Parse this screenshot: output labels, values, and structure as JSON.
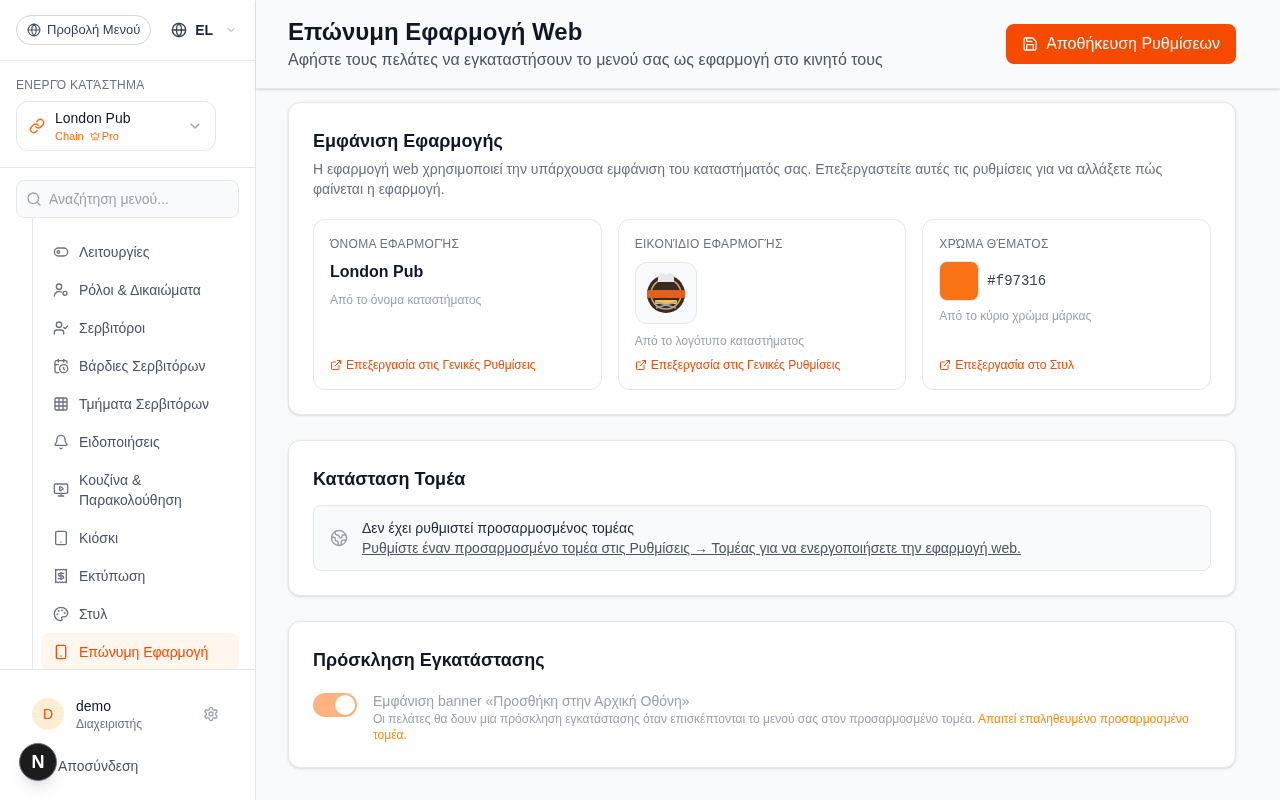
{
  "sidebar": {
    "menu_button": {
      "label": "Προβολή Μενού"
    },
    "language": {
      "label": "EL"
    },
    "store_heading": "ΕΝΕΡΓΌ ΚΑΤΆΣΤΗΜΑ",
    "store": {
      "name": "London Pub",
      "type": "Chain",
      "plan": "Pro"
    },
    "search": {
      "placeholder": "Αναζήτηση μενού..."
    },
    "nav_items": [
      {
        "label": "Λειτουργίες",
        "selected": false
      },
      {
        "label": "Ρόλοι & Δικαιώματα",
        "selected": false
      },
      {
        "label": "Σερβιτόροι",
        "selected": false
      },
      {
        "label": "Βάρδιες Σερβιτόρων",
        "selected": false
      },
      {
        "label": "Τμήματα Σερβιτόρων",
        "selected": false
      },
      {
        "label": "Ειδοποιήσεις",
        "selected": false
      },
      {
        "label": "Κουζίνα & Παρακολούθηση",
        "selected": false
      },
      {
        "label": "Κιόσκι",
        "selected": false
      },
      {
        "label": "Εκτύπωση",
        "selected": false
      },
      {
        "label": "Στυλ",
        "selected": false
      },
      {
        "label": "Επώνυμη Εφαρμογή",
        "selected": true
      }
    ],
    "user": {
      "initial": "D",
      "name": "demo",
      "role": "Διαχειριστής"
    },
    "logout": {
      "label": "Αποσύνδεση"
    }
  },
  "dev_badge": {
    "label": "N"
  },
  "header": {
    "title": "Επώνυμη Εφαρμογή Web",
    "subtitle": "Αφήστε τους πελάτες να εγκαταστήσουν το μενού σας ως εφαρμογή στο κινητό τους",
    "save_button": {
      "label": "Αποθήκευση Ρυθμίσεων"
    }
  },
  "app_appearance": {
    "title": "Εμφάνιση Εφαρμογής",
    "description": "Η εφαρμογή web χρησιμοποιεί την υπάρχουσα εμφάνιση του καταστήματός σας. Επεξεργαστείτε αυτές τις ρυθμίσεις για να αλλάξετε πώς φαίνεται η εφαρμογή.",
    "cards": [
      {
        "kind": "text",
        "label": "ΌΝΟΜΑ ΕΦΑΡΜΟΓΉΣ",
        "value": "London Pub",
        "source": "Από το όνομα καταστήματος",
        "link": "Επεξεργασία στις Γενικές Ρυθμίσεις"
      },
      {
        "kind": "image",
        "label": "ΕΙΚΟΝΊΔΙΟ ΕΦΑΡΜΟΓΉΣ",
        "source": "Από το λογότυπο καταστήματος",
        "link": "Επεξεργασία στις Γενικές Ρυθμίσεις"
      },
      {
        "kind": "color",
        "label": "ΧΡΏΜΑ ΘΈΜΑΤΟΣ",
        "color": "#f97316",
        "value": "#f97316",
        "source": "Από το κύριο χρώμα μάρκας",
        "link": "Επεξεργασία στο Στυλ"
      }
    ]
  },
  "domain_status": {
    "title": "Κατάσταση Τομέα",
    "notice": {
      "title": "Δεν έχει ρυθμιστεί προσαρμοσμένος τομέας",
      "link": "Ρυθμίστε έναν προσαρμοσμένο τομέα στις Ρυθμίσεις → Τομέας για να ενεργοποιήσετε την εφαρμογή web."
    }
  },
  "install_prompt": {
    "title": "Πρόσκληση Εγκατάστασης",
    "toggle": {
      "on": true,
      "disabled": true
    },
    "label": "Εμφάνιση banner «Προσθήκη στην Αρχική Οθόνη»",
    "description": "Οι πελάτες θα δουν μια πρόσκληση εγκατάστασης όταν επισκέπτονται το μενού σας στον προσαρμοσμένο τομέα.",
    "note": "Απαιτεί επαληθευμένο προσαρμοσμένο τομέα."
  }
}
